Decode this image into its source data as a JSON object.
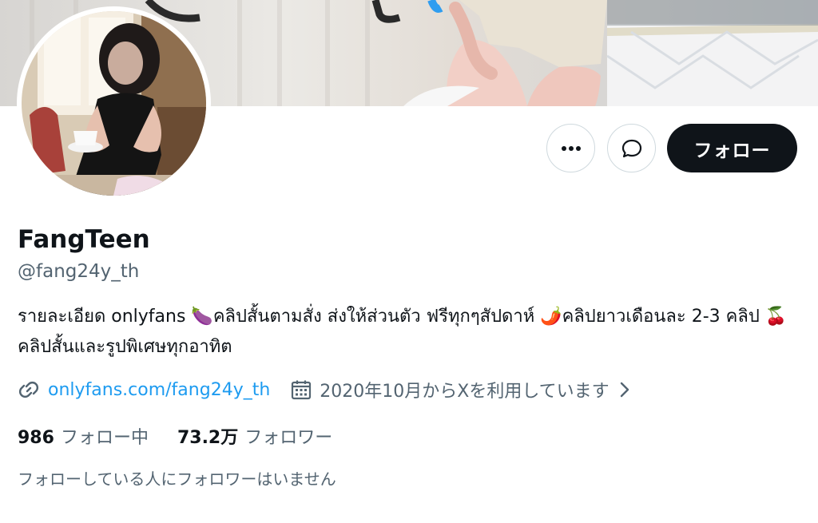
{
  "profile": {
    "display_name": "FangTeen",
    "handle": "@fang24y_th",
    "bio": {
      "part1": "รายละเอียด onlyfans ",
      "emoji1": "🍆",
      "part2": "คลิปสั้นตามสั่ง ส่งให้ส่วนตัว ฟรีทุกๆสัปดาห์ ",
      "emoji2": "🌶️",
      "part3": "คลิปยาวเดือนละ 2-3 คลิป ",
      "emoji3": "🍒",
      "part4": "คลิปสั้นและรูปพิเศษทุกอาทิต"
    },
    "link": "onlyfans.com/fang24y_th",
    "joined": "2020年10月からXを利用しています",
    "following_count": "986",
    "following_label": "フォロー中",
    "followers_count": "73.2万",
    "followers_label": "フォロワー",
    "followed_by_text": "フォローしている人にフォロワーはいません"
  },
  "actions": {
    "more_icon": "more-horizontal-icon",
    "message_icon": "message-bubble-icon",
    "follow_label": "フォロー"
  },
  "icons": {
    "link": "link-icon",
    "calendar": "calendar-icon",
    "chevron": "chevron-right-icon"
  },
  "colors": {
    "accent_link": "#1d9bf0",
    "secondary_text": "#536471",
    "primary_text": "#0f1419",
    "follow_button": "#0f1419",
    "border": "#cfd9de"
  }
}
